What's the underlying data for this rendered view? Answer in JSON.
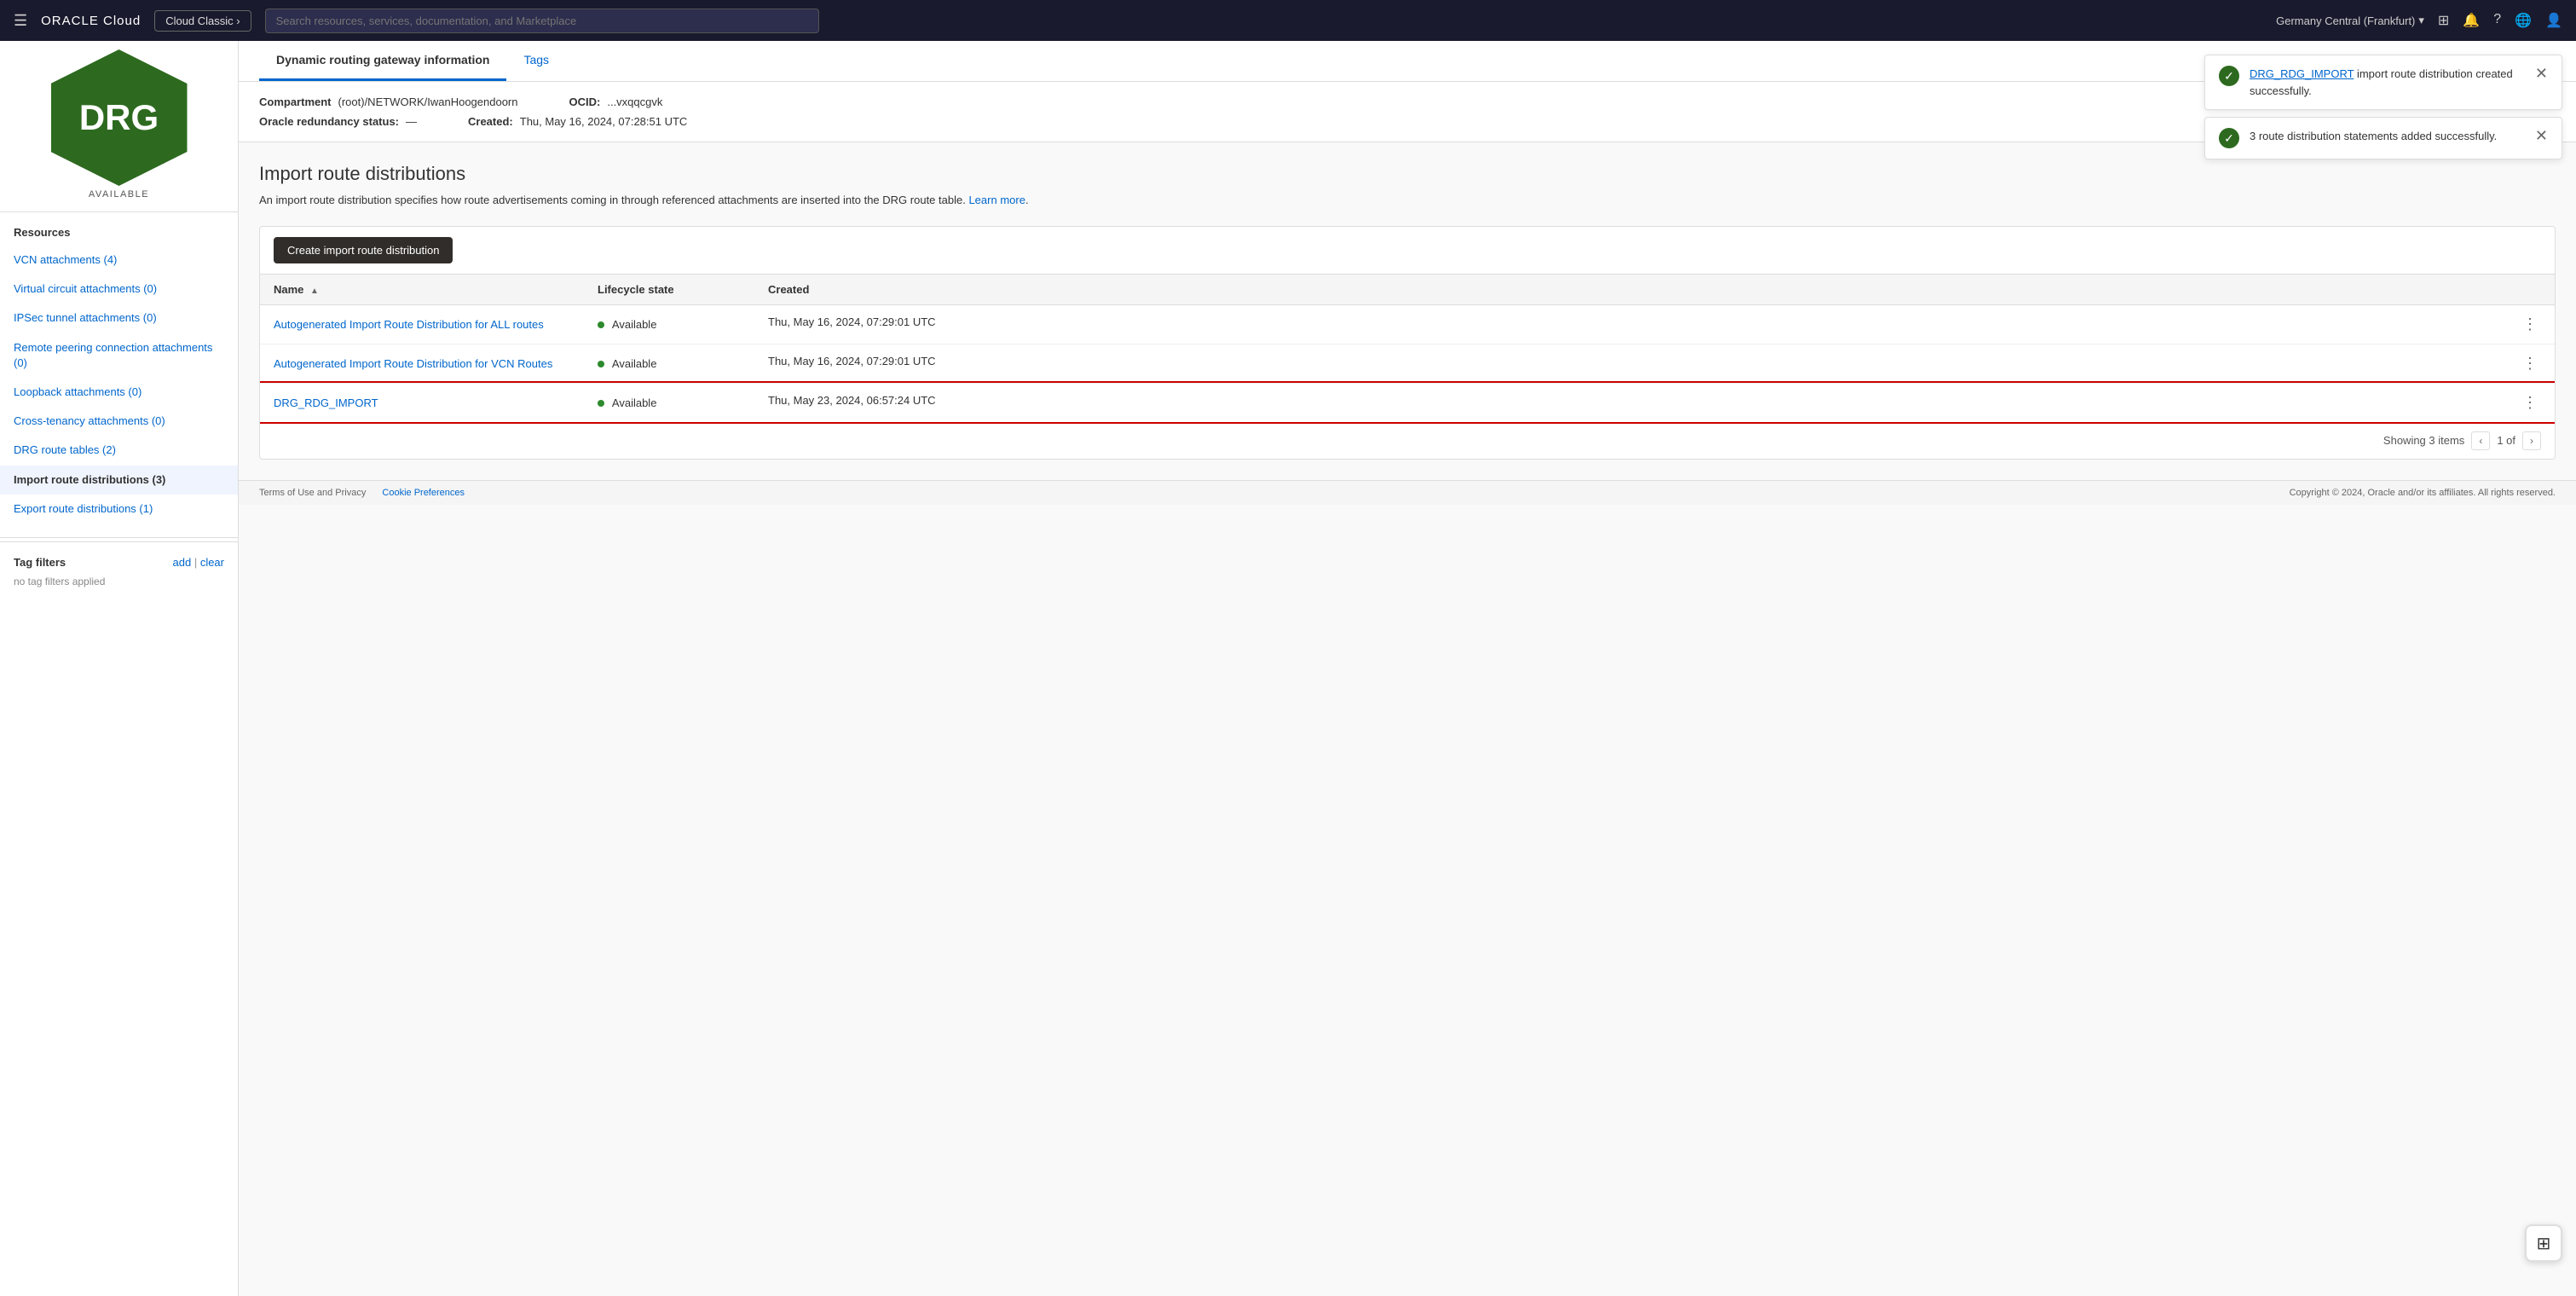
{
  "nav": {
    "hamburger": "☰",
    "oracle_logo": "ORACLE Cloud",
    "cloud_classic_btn": "Cloud Classic ›",
    "search_placeholder": "Search resources, services, documentation, and Marketplace",
    "region": "Germany Central (Frankfurt)",
    "region_icon": "▾",
    "icons": [
      "⊞",
      "🔔",
      "?",
      "🌐",
      "👤"
    ]
  },
  "sidebar": {
    "drg_text": "DRG",
    "available_label": "AVAILABLE",
    "resources_label": "Resources",
    "items": [
      {
        "label": "VCN attachments (4)",
        "active": false
      },
      {
        "label": "Virtual circuit attachments (0)",
        "active": false
      },
      {
        "label": "IPSec tunnel attachments (0)",
        "active": false
      },
      {
        "label": "Remote peering connection attachments (0)",
        "active": false
      },
      {
        "label": "Loopback attachments (0)",
        "active": false
      },
      {
        "label": "Cross-tenancy attachments (0)",
        "active": false
      },
      {
        "label": "DRG route tables (2)",
        "active": false
      },
      {
        "label": "Import route distributions (3)",
        "active": true
      },
      {
        "label": "Export route distributions (1)",
        "active": false
      }
    ],
    "tag_filters_label": "Tag filters",
    "add_link": "add",
    "clear_link": "clear",
    "no_filters_text": "no tag filters applied"
  },
  "toasts": [
    {
      "id": "toast1",
      "link_text": "DRG_RDG_IMPORT",
      "message": " import route distribution created successfully.",
      "close": "✕"
    },
    {
      "id": "toast2",
      "message": "3 route distribution statements added successfully.",
      "close": "✕"
    }
  ],
  "tabs": [
    {
      "label": "Dynamic routing gateway information",
      "active": true
    },
    {
      "label": "Tags",
      "active": false
    }
  ],
  "drg_info": {
    "compartment_label": "Compartment",
    "compartment_value": "(root)/NETWORK/IwanHoogendoorn",
    "ocid_label": "OCID:",
    "ocid_value": "...vxqqcgvk",
    "redundancy_label": "Oracle redundancy status:",
    "redundancy_value": "—",
    "created_label": "Created:",
    "created_value": "Thu, May 16, 2024, 07:28:51 UTC"
  },
  "section": {
    "title": "Import route distributions",
    "description": "An import route distribution specifies how route advertisements coming in through referenced attachments are inserted into the DRG route table.",
    "learn_more": "Learn more",
    "create_btn": "Create import route distribution"
  },
  "table": {
    "columns": [
      {
        "label": "Name",
        "sortable": true
      },
      {
        "label": "Lifecycle state",
        "sortable": false
      },
      {
        "label": "Created",
        "sortable": false
      }
    ],
    "rows": [
      {
        "name": "Autogenerated Import Route Distribution for ALL routes",
        "state": "Available",
        "created": "Thu, May 16, 2024, 07:29:01 UTC",
        "highlighted": false
      },
      {
        "name": "Autogenerated Import Route Distribution for VCN Routes",
        "state": "Available",
        "created": "Thu, May 16, 2024, 07:29:01 UTC",
        "highlighted": false
      },
      {
        "name": "DRG_RDG_IMPORT",
        "state": "Available",
        "created": "Thu, May 23, 2024, 06:57:24 UTC",
        "highlighted": true
      }
    ],
    "footer": {
      "showing": "Showing 3 items",
      "page_info": "1 of",
      "prev_btn": "‹",
      "next_btn": "›"
    }
  },
  "footer": {
    "links": [
      {
        "label": "Terms of Use and Privacy"
      },
      {
        "label": "Cookie Preferences"
      }
    ],
    "copyright": "Copyright © 2024, Oracle and/or its affiliates. All rights reserved."
  },
  "help_widget_icon": "⊞"
}
